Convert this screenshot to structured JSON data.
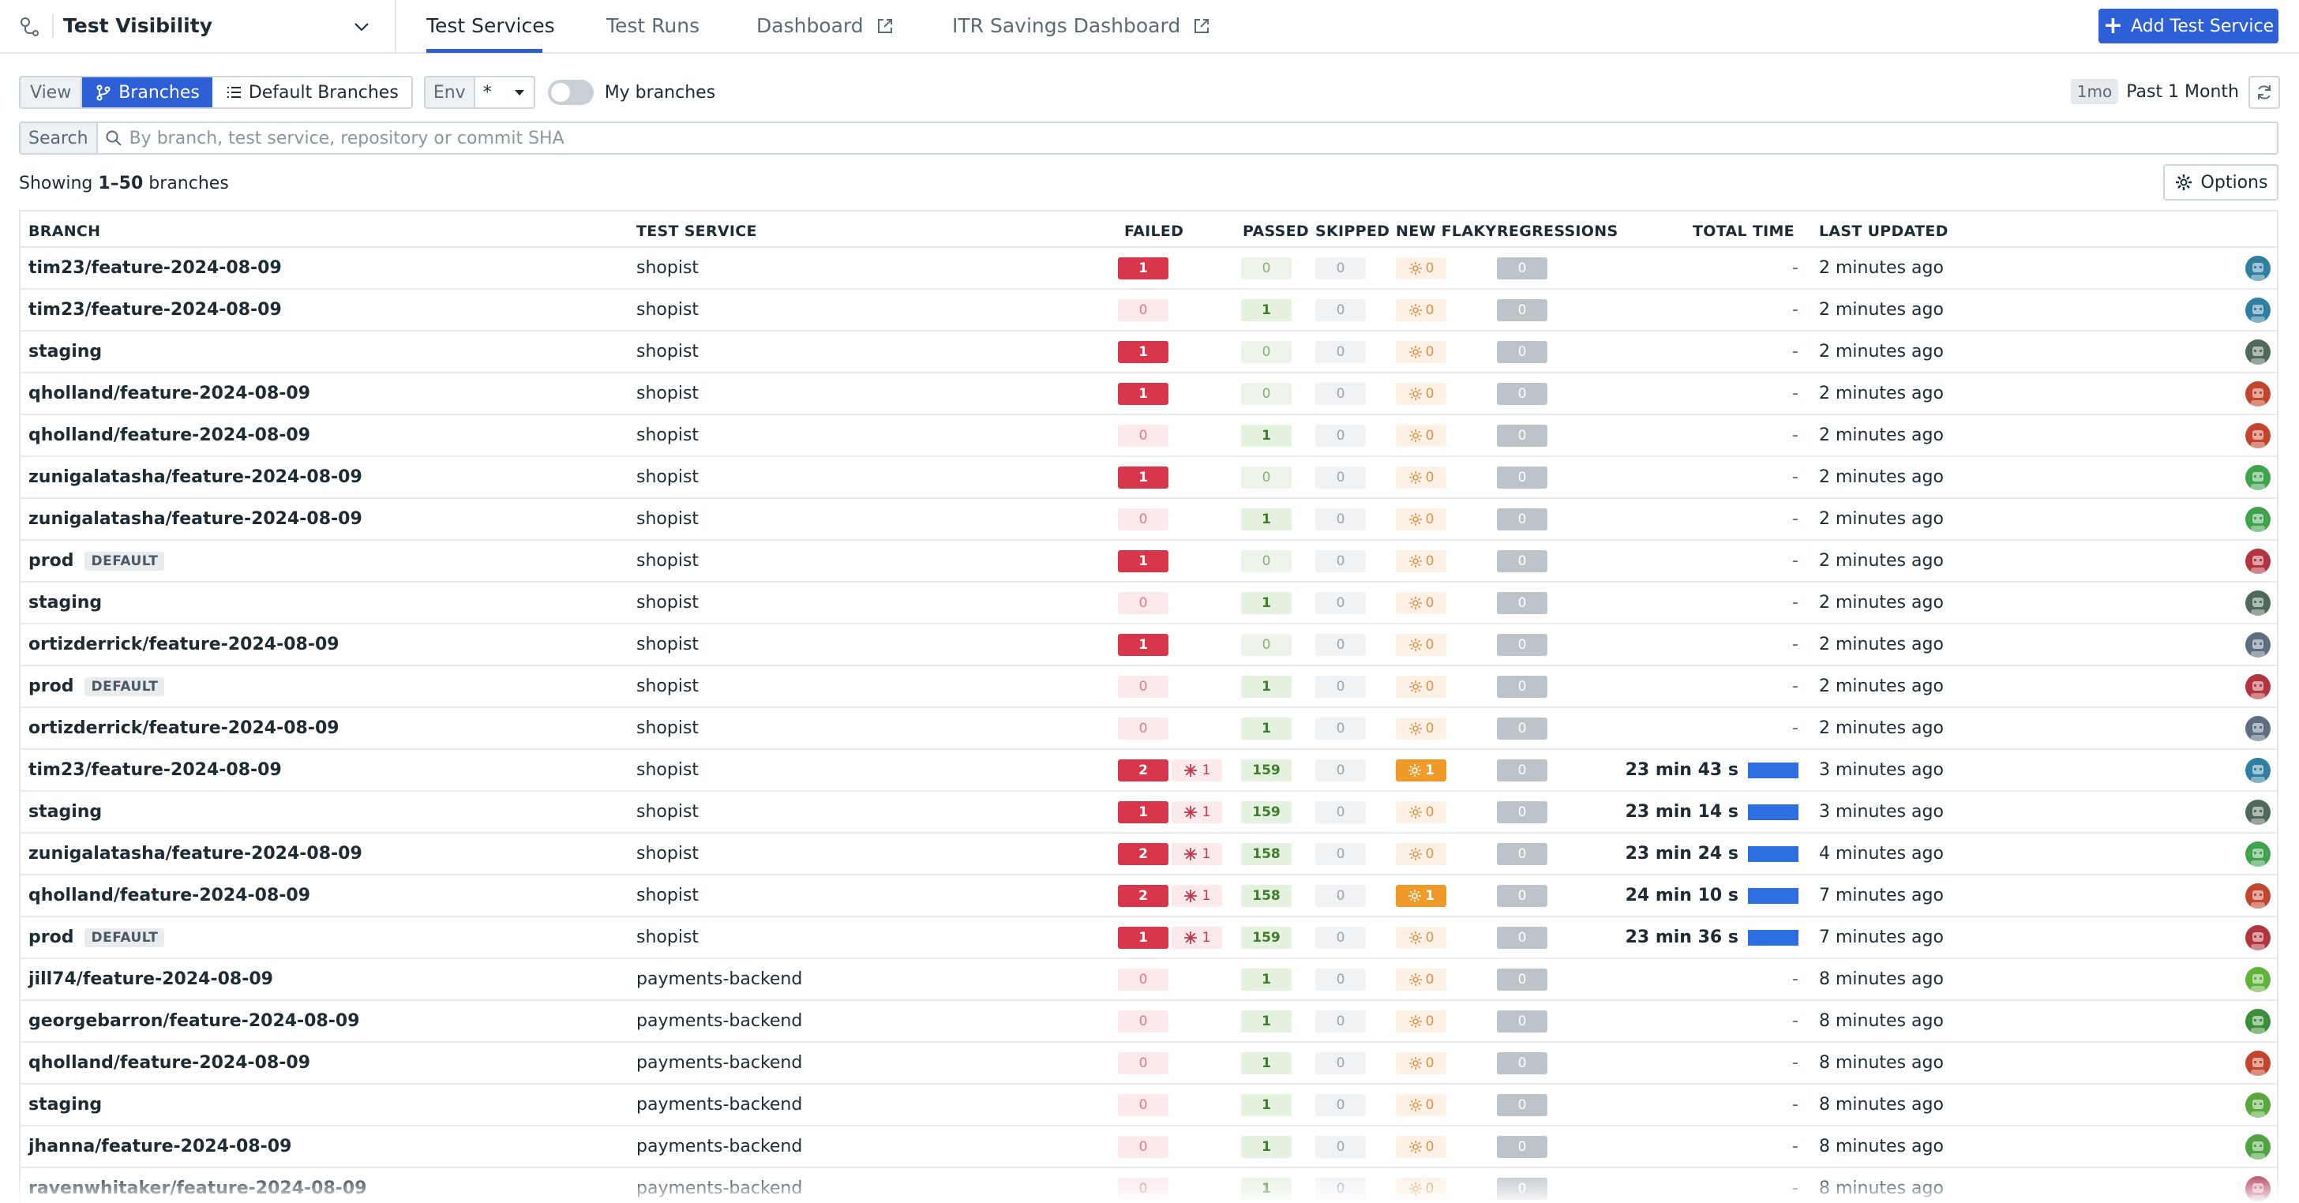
{
  "app": {
    "title": "Test Visibility"
  },
  "tabs": [
    {
      "label": "Test Services",
      "active": true,
      "external": false
    },
    {
      "label": "Test Runs",
      "active": false,
      "external": false
    },
    {
      "label": "Dashboard",
      "active": false,
      "external": true
    },
    {
      "label": "ITR Savings Dashboard",
      "active": false,
      "external": true
    }
  ],
  "add_button": "Add Test Service",
  "toolbar": {
    "view_label": "View",
    "branches_label": "Branches",
    "default_branches_label": "Default Branches",
    "env_label": "Env",
    "env_value": "*",
    "my_branches_label": "My branches",
    "my_branches_on": false,
    "time_pill": "1mo",
    "time_label": "Past 1 Month"
  },
  "search": {
    "label": "Search",
    "placeholder": "By branch, test service, repository or commit SHA"
  },
  "showing": {
    "prefix": "Showing ",
    "range": "1–50",
    "suffix": " branches"
  },
  "options_label": "Options",
  "columns": {
    "branch": "BRANCH",
    "service": "TEST SERVICE",
    "failed": "FAILED",
    "passed": "PASSED",
    "skipped": "SKIPPED",
    "new_flaky": "NEW FLAKY",
    "regressions": "REGRESSIONS",
    "total_time": "TOTAL TIME",
    "last_updated": "LAST UPDATED"
  },
  "default_tag": "DEFAULT",
  "rows": [
    {
      "branch": "tim23/feature-2024-08-09",
      "default": false,
      "service": "shopist",
      "failed": "1",
      "flaky": null,
      "passed": "0",
      "skipped": "0",
      "new_flaky": "0",
      "regressions": "0",
      "total_time": "-",
      "updated": "2 minutes ago",
      "avatar": "#2f7fa0"
    },
    {
      "branch": "tim23/feature-2024-08-09",
      "default": false,
      "service": "shopist",
      "failed": "0",
      "flaky": null,
      "passed": "1",
      "skipped": "0",
      "new_flaky": "0",
      "regressions": "0",
      "total_time": "-",
      "updated": "2 minutes ago",
      "avatar": "#2f7fa0"
    },
    {
      "branch": "staging",
      "default": false,
      "service": "shopist",
      "failed": "1",
      "flaky": null,
      "passed": "0",
      "skipped": "0",
      "new_flaky": "0",
      "regressions": "0",
      "total_time": "-",
      "updated": "2 minutes ago",
      "avatar": "#4f6a5a"
    },
    {
      "branch": "qholland/feature-2024-08-09",
      "default": false,
      "service": "shopist",
      "failed": "1",
      "flaky": null,
      "passed": "0",
      "skipped": "0",
      "new_flaky": "0",
      "regressions": "0",
      "total_time": "-",
      "updated": "2 minutes ago",
      "avatar": "#c4452d"
    },
    {
      "branch": "qholland/feature-2024-08-09",
      "default": false,
      "service": "shopist",
      "failed": "0",
      "flaky": null,
      "passed": "1",
      "skipped": "0",
      "new_flaky": "0",
      "regressions": "0",
      "total_time": "-",
      "updated": "2 minutes ago",
      "avatar": "#c4452d"
    },
    {
      "branch": "zunigalatasha/feature-2024-08-09",
      "default": false,
      "service": "shopist",
      "failed": "1",
      "flaky": null,
      "passed": "0",
      "skipped": "0",
      "new_flaky": "0",
      "regressions": "0",
      "total_time": "-",
      "updated": "2 minutes ago",
      "avatar": "#3fa34d"
    },
    {
      "branch": "zunigalatasha/feature-2024-08-09",
      "default": false,
      "service": "shopist",
      "failed": "0",
      "flaky": null,
      "passed": "1",
      "skipped": "0",
      "new_flaky": "0",
      "regressions": "0",
      "total_time": "-",
      "updated": "2 minutes ago",
      "avatar": "#3fa34d"
    },
    {
      "branch": "prod",
      "default": true,
      "service": "shopist",
      "failed": "1",
      "flaky": null,
      "passed": "0",
      "skipped": "0",
      "new_flaky": "0",
      "regressions": "0",
      "total_time": "-",
      "updated": "2 minutes ago",
      "avatar": "#b1343f"
    },
    {
      "branch": "staging",
      "default": false,
      "service": "shopist",
      "failed": "0",
      "flaky": null,
      "passed": "1",
      "skipped": "0",
      "new_flaky": "0",
      "regressions": "0",
      "total_time": "-",
      "updated": "2 minutes ago",
      "avatar": "#4f6a5a"
    },
    {
      "branch": "ortizderrick/feature-2024-08-09",
      "default": false,
      "service": "shopist",
      "failed": "1",
      "flaky": null,
      "passed": "0",
      "skipped": "0",
      "new_flaky": "0",
      "regressions": "0",
      "total_time": "-",
      "updated": "2 minutes ago",
      "avatar": "#5e6e80"
    },
    {
      "branch": "prod",
      "default": true,
      "service": "shopist",
      "failed": "0",
      "flaky": null,
      "passed": "1",
      "skipped": "0",
      "new_flaky": "0",
      "regressions": "0",
      "total_time": "-",
      "updated": "2 minutes ago",
      "avatar": "#b1343f"
    },
    {
      "branch": "ortizderrick/feature-2024-08-09",
      "default": false,
      "service": "shopist",
      "failed": "0",
      "flaky": null,
      "passed": "1",
      "skipped": "0",
      "new_flaky": "0",
      "regressions": "0",
      "total_time": "-",
      "updated": "2 minutes ago",
      "avatar": "#5e6e80"
    },
    {
      "branch": "tim23/feature-2024-08-09",
      "default": false,
      "service": "shopist",
      "failed": "2",
      "flaky": "1",
      "passed": "159",
      "skipped": "0",
      "new_flaky": "1",
      "regressions": "0",
      "total_time": "23 min 43 s",
      "updated": "3 minutes ago",
      "avatar": "#2f7fa0"
    },
    {
      "branch": "staging",
      "default": false,
      "service": "shopist",
      "failed": "1",
      "flaky": "1",
      "passed": "159",
      "skipped": "0",
      "new_flaky": "0",
      "regressions": "0",
      "total_time": "23 min 14 s",
      "updated": "3 minutes ago",
      "avatar": "#4f6a5a"
    },
    {
      "branch": "zunigalatasha/feature-2024-08-09",
      "default": false,
      "service": "shopist",
      "failed": "2",
      "flaky": "1",
      "passed": "158",
      "skipped": "0",
      "new_flaky": "0",
      "regressions": "0",
      "total_time": "23 min 24 s",
      "updated": "4 minutes ago",
      "avatar": "#3fa34d"
    },
    {
      "branch": "qholland/feature-2024-08-09",
      "default": false,
      "service": "shopist",
      "failed": "2",
      "flaky": "1",
      "passed": "158",
      "skipped": "0",
      "new_flaky": "1",
      "regressions": "0",
      "total_time": "24 min 10 s",
      "updated": "7 minutes ago",
      "avatar": "#c4452d"
    },
    {
      "branch": "prod",
      "default": true,
      "service": "shopist",
      "failed": "1",
      "flaky": "1",
      "passed": "159",
      "skipped": "0",
      "new_flaky": "0",
      "regressions": "0",
      "total_time": "23 min 36 s",
      "updated": "7 minutes ago",
      "avatar": "#b1343f"
    },
    {
      "branch": "jill74/feature-2024-08-09",
      "default": false,
      "service": "payments-backend",
      "failed": "0",
      "flaky": null,
      "passed": "1",
      "skipped": "0",
      "new_flaky": "0",
      "regressions": "0",
      "total_time": "-",
      "updated": "8 minutes ago",
      "avatar": "#5fb33a"
    },
    {
      "branch": "georgebarron/feature-2024-08-09",
      "default": false,
      "service": "payments-backend",
      "failed": "0",
      "flaky": null,
      "passed": "1",
      "skipped": "0",
      "new_flaky": "0",
      "regressions": "0",
      "total_time": "-",
      "updated": "8 minutes ago",
      "avatar": "#3c8f3a"
    },
    {
      "branch": "qholland/feature-2024-08-09",
      "default": false,
      "service": "payments-backend",
      "failed": "0",
      "flaky": null,
      "passed": "1",
      "skipped": "0",
      "new_flaky": "0",
      "regressions": "0",
      "total_time": "-",
      "updated": "8 minutes ago",
      "avatar": "#c4452d"
    },
    {
      "branch": "staging",
      "default": false,
      "service": "payments-backend",
      "failed": "0",
      "flaky": null,
      "passed": "1",
      "skipped": "0",
      "new_flaky": "0",
      "regressions": "0",
      "total_time": "-",
      "updated": "8 minutes ago",
      "avatar": "#58a83c"
    },
    {
      "branch": "jhanna/feature-2024-08-09",
      "default": false,
      "service": "payments-backend",
      "failed": "0",
      "flaky": null,
      "passed": "1",
      "skipped": "0",
      "new_flaky": "0",
      "regressions": "0",
      "total_time": "-",
      "updated": "8 minutes ago",
      "avatar": "#4fa340"
    },
    {
      "branch": "ravenwhitaker/feature-2024-08-09",
      "default": false,
      "service": "payments-backend",
      "failed": "0",
      "flaky": null,
      "passed": "1",
      "skipped": "0",
      "new_flaky": "0",
      "regressions": "0",
      "total_time": "-",
      "updated": "8 minutes ago",
      "avatar": "#b13a5a"
    }
  ]
}
